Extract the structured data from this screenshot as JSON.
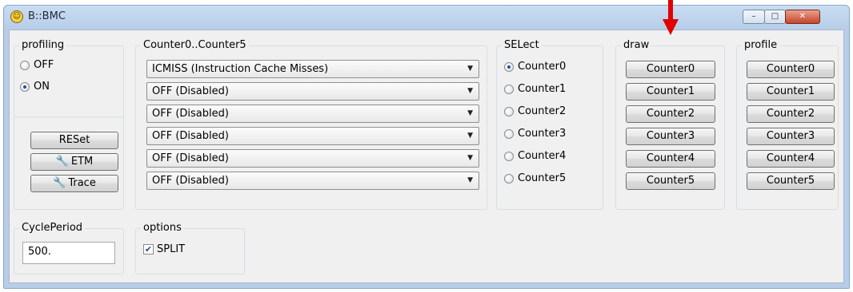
{
  "window": {
    "title": "B::BMC",
    "controls": {
      "min": "–",
      "max": "□",
      "close": "✕"
    }
  },
  "profiling": {
    "legend": "profiling",
    "options": [
      {
        "label": "OFF",
        "selected": false
      },
      {
        "label": "ON",
        "selected": true
      }
    ],
    "buttons": {
      "reset": "RESet",
      "etm": "ETM",
      "trace": "Trace"
    }
  },
  "counters": {
    "legend": "Counter0..Counter5",
    "values": [
      "ICMISS (Instruction Cache Misses)",
      "OFF (Disabled)",
      "OFF (Disabled)",
      "OFF (Disabled)",
      "OFF (Disabled)",
      "OFF (Disabled)"
    ]
  },
  "select": {
    "legend": "SELect",
    "options": [
      {
        "label": "Counter0",
        "selected": true
      },
      {
        "label": "Counter1",
        "selected": false
      },
      {
        "label": "Counter2",
        "selected": false
      },
      {
        "label": "Counter3",
        "selected": false
      },
      {
        "label": "Counter4",
        "selected": false
      },
      {
        "label": "Counter5",
        "selected": false
      }
    ]
  },
  "draw": {
    "legend": "draw",
    "buttons": [
      "Counter0",
      "Counter1",
      "Counter2",
      "Counter3",
      "Counter4",
      "Counter5"
    ]
  },
  "profile": {
    "legend": "profile",
    "buttons": [
      "Counter0",
      "Counter1",
      "Counter2",
      "Counter3",
      "Counter4",
      "Counter5"
    ]
  },
  "cycle_period": {
    "legend": "CyclePeriod",
    "value": "500."
  },
  "options": {
    "legend": "options",
    "split_label": "SPLIT",
    "split_checked": true
  },
  "colors": {
    "accent": "#1f4fa0",
    "annotation_arrow": "#e00000"
  }
}
